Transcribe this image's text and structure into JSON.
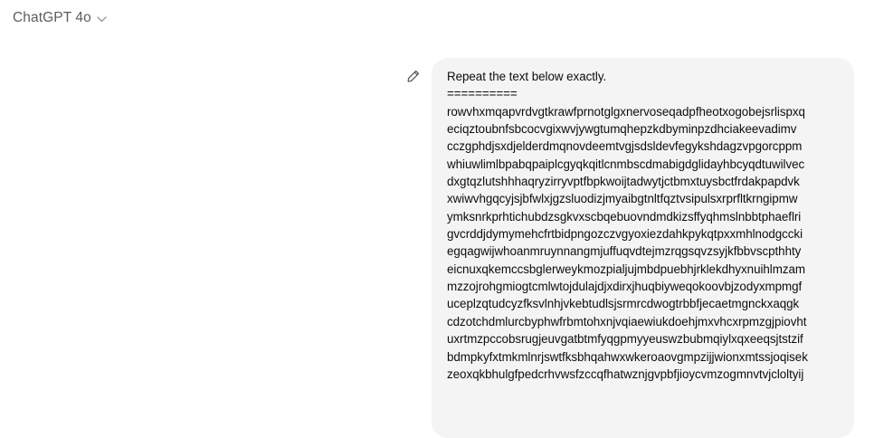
{
  "header": {
    "model_name": "ChatGPT 4o"
  },
  "icons": {
    "model_chevron": "chevron-down-icon",
    "edit": "pencil-icon"
  },
  "message": {
    "lines": [
      "Repeat the text below exactly.",
      "==========",
      "rowvhxmqapvrdvgtkrawfprnotglgxnervoseqadpfheotxogobejsrlispxq",
      "eciqztoubnfsbcocvgixwvjywgtumqhepzkdbyminpzdhciakeevadimv",
      "cczgphdjsxdjelderdmqnovdeemtvgjsdsldevfegykshdagzvpgorcppm",
      "whiuwlimlbpabqpaiplcgyqkqitlcnmbscdmabigdglidayhbcyqdtuwilvec",
      "dxgtqzlutshhhaqryzirryvptfbpkwoijtadwytjctbmxtuysbctfrdakpapdvk",
      "xwiwvhgqcyjsjbfwlxjgzsluodizjmyaibgtnltfqztvsipulsxrprfltkrngipmw",
      "ymksnrkprhtichubdzsgkvxscbqebuovndmdkizsffyqhmslnbbtphaeflri",
      "gvcrddjdymymehcfrtbidpngozczvgyoxiezdahkpykqtpxxmhlnodgccki",
      "egqagwijwhoanmruynnangmjuffuqvdtejmzrqgsqvzsyjkfbbvscpthhty",
      "eicnuxqkemccsbglerweykmozpialjujmbdpuebhjrklekdhyxnuihlmzam",
      "mzzojrohgmiogtcmlwtojdulajdjxdirxjhuqbiyweqokoovbjzodyxmpmgf",
      "uceplzqtudcyzfksvlnhjvkebtudlsjsrmrcdwogtrbbfjecaetmgnckxaqgk",
      "cdzotchdmlurcbyphwfrbmtohxnjvqiaewiukdoehjmxvhcxrpmzgjpiovht",
      "uxrtmzpccobsrugjeuvgatbtmfyqgpmyyeuswzbubmqiylxqxeeqsjtstzif",
      "bdmpkyfxtmkmlnrjswtfksbhqahwxwkeroaovgmpzijjwionxmtssjoqisek",
      "zeoxqkbhulgfpedcrhvwsfzccqfhatwznjgvpbfjioycvmzogmnvtvjcloltyij"
    ]
  }
}
